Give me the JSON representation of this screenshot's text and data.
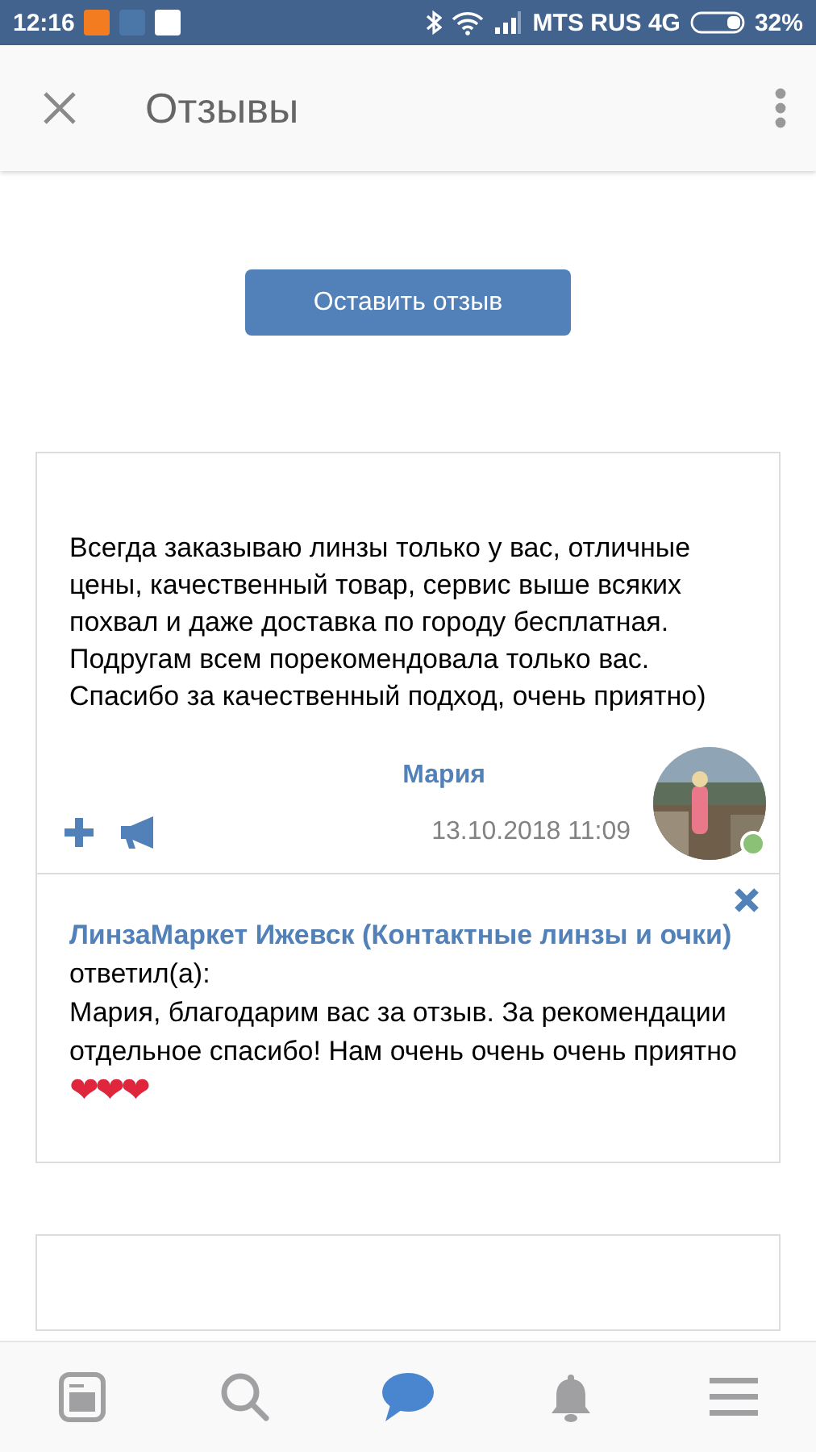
{
  "status_bar": {
    "time": "12:16",
    "carrier": "MTS RUS 4G",
    "battery": "32%"
  },
  "header": {
    "title": "Отзывы"
  },
  "leave_review_button": "Оставить отзыв",
  "review": {
    "text": "Всегда заказываю линзы только у вас, отличные цены, качественный товар, сервис выше всяких похвал и даже доставка по городу бесплатная. Подругам всем порекомендовала только вас. Спасибо за качественный подход, очень приятно)",
    "author": "Мария",
    "date": "13.10.2018 11:09",
    "online": true,
    "reply": {
      "author": "ЛинзаМаркет Ижевск (Контактные линзы и очки)",
      "verb": "ответил(а):",
      "text": "Мария, благодарим вас за отзыв. За рекомендации отдельное спасибо! Нам очень очень очень приятно",
      "hearts": "❤❤❤"
    }
  },
  "bottom_nav": [
    {
      "kind": "news",
      "selected": false
    },
    {
      "kind": "search",
      "selected": false
    },
    {
      "kind": "messages",
      "selected": true
    },
    {
      "kind": "notifications",
      "selected": false
    },
    {
      "kind": "menu",
      "selected": false
    }
  ]
}
